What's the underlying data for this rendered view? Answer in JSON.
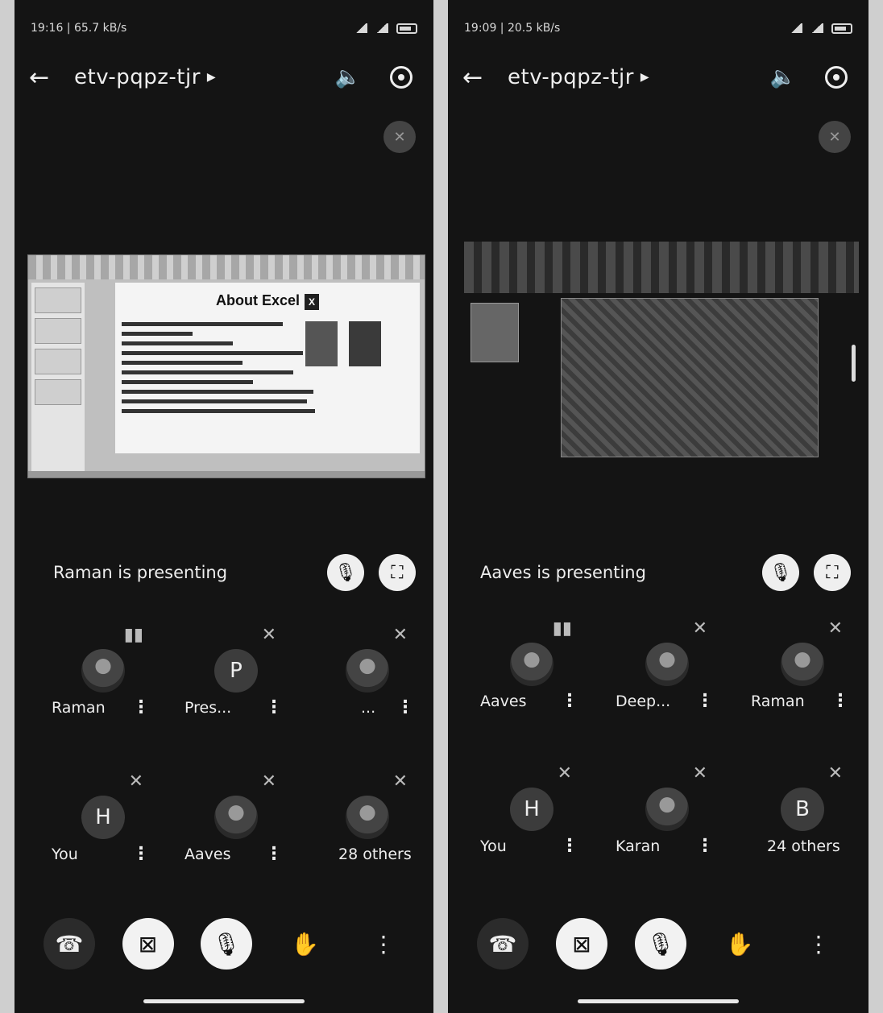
{
  "screens": [
    {
      "status_time": "19:16 | 65.7 kB/s",
      "meeting_code": "etv-pqpz-tjr",
      "presenting_text": "Raman is presenting",
      "slide_title": "About Excel",
      "participants": [
        {
          "name": "Raman",
          "avatar": "",
          "mic": "speaking"
        },
        {
          "name": "Pres...",
          "avatar": "P",
          "mic": "muted"
        },
        {
          "name": "...",
          "avatar": "",
          "mic": "muted"
        },
        {
          "name": "You",
          "avatar": "H",
          "mic": "muted"
        },
        {
          "name": "Aaves",
          "avatar": "",
          "mic": "muted"
        },
        {
          "name": "28 others",
          "avatar": "",
          "mic": "muted"
        }
      ]
    },
    {
      "status_time": "19:09 | 20.5 kB/s",
      "meeting_code": "etv-pqpz-tjr",
      "presenting_text": "Aaves is presenting",
      "participants": [
        {
          "name": "Aaves",
          "avatar": "",
          "mic": "speaking"
        },
        {
          "name": "Deep...",
          "avatar": "",
          "mic": "muted"
        },
        {
          "name": "Raman",
          "avatar": "",
          "mic": "muted"
        },
        {
          "name": "You",
          "avatar": "H",
          "mic": "muted"
        },
        {
          "name": "Karan",
          "avatar": "",
          "mic": "muted"
        },
        {
          "name": "24 others",
          "avatar": "B",
          "mic": "muted"
        }
      ]
    }
  ],
  "icons": {
    "back": "arrow-left-icon",
    "speaker": "speaker-icon",
    "switch_camera": "switch-camera-icon",
    "mic_off": "mic-off-icon",
    "fullscreen": "fullscreen-icon",
    "end_call": "end-call-icon",
    "camera_off": "camera-off-icon",
    "hand": "raise-hand-icon",
    "more": "more-vertical-icon"
  }
}
